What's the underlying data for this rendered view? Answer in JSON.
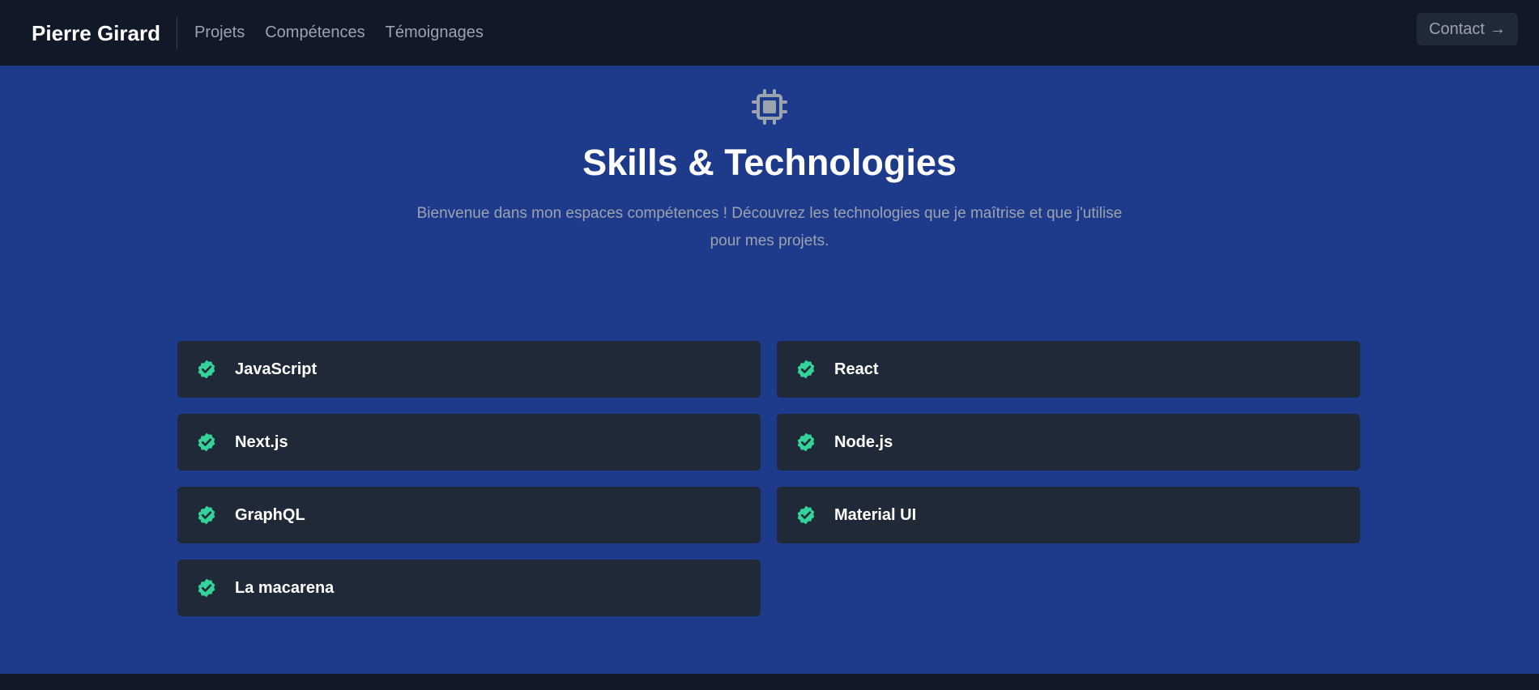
{
  "navbar": {
    "brand": "Pierre Girard",
    "links": [
      "Projets",
      "Compétences",
      "Témoignages"
    ],
    "contact_label": "Contact",
    "contact_icon": "arrow-right-icon"
  },
  "section": {
    "icon": "chip-icon",
    "title": "Skills & Technologies",
    "description_line1": "Bienvenue dans mon espaces compétences ! Découvrez les technologies que je maîtrise et que j'utilise",
    "description_line2": "pour mes projets."
  },
  "skills": [
    {
      "label": "JavaScript",
      "icon": "check-badge-icon"
    },
    {
      "label": "React",
      "icon": "check-badge-icon"
    },
    {
      "label": "Next.js",
      "icon": "check-badge-icon"
    },
    {
      "label": "Node.js",
      "icon": "check-badge-icon"
    },
    {
      "label": "GraphQL",
      "icon": "check-badge-icon"
    },
    {
      "label": "Material UI",
      "icon": "check-badge-icon"
    },
    {
      "label": "La macarena",
      "icon": "check-badge-icon"
    }
  ],
  "colors": {
    "navbar_bg": "#111827",
    "hero_bg": "#1e3a8a",
    "card_bg": "#1f2937",
    "check_green": "#34d399",
    "muted_text": "#9ca3af"
  }
}
